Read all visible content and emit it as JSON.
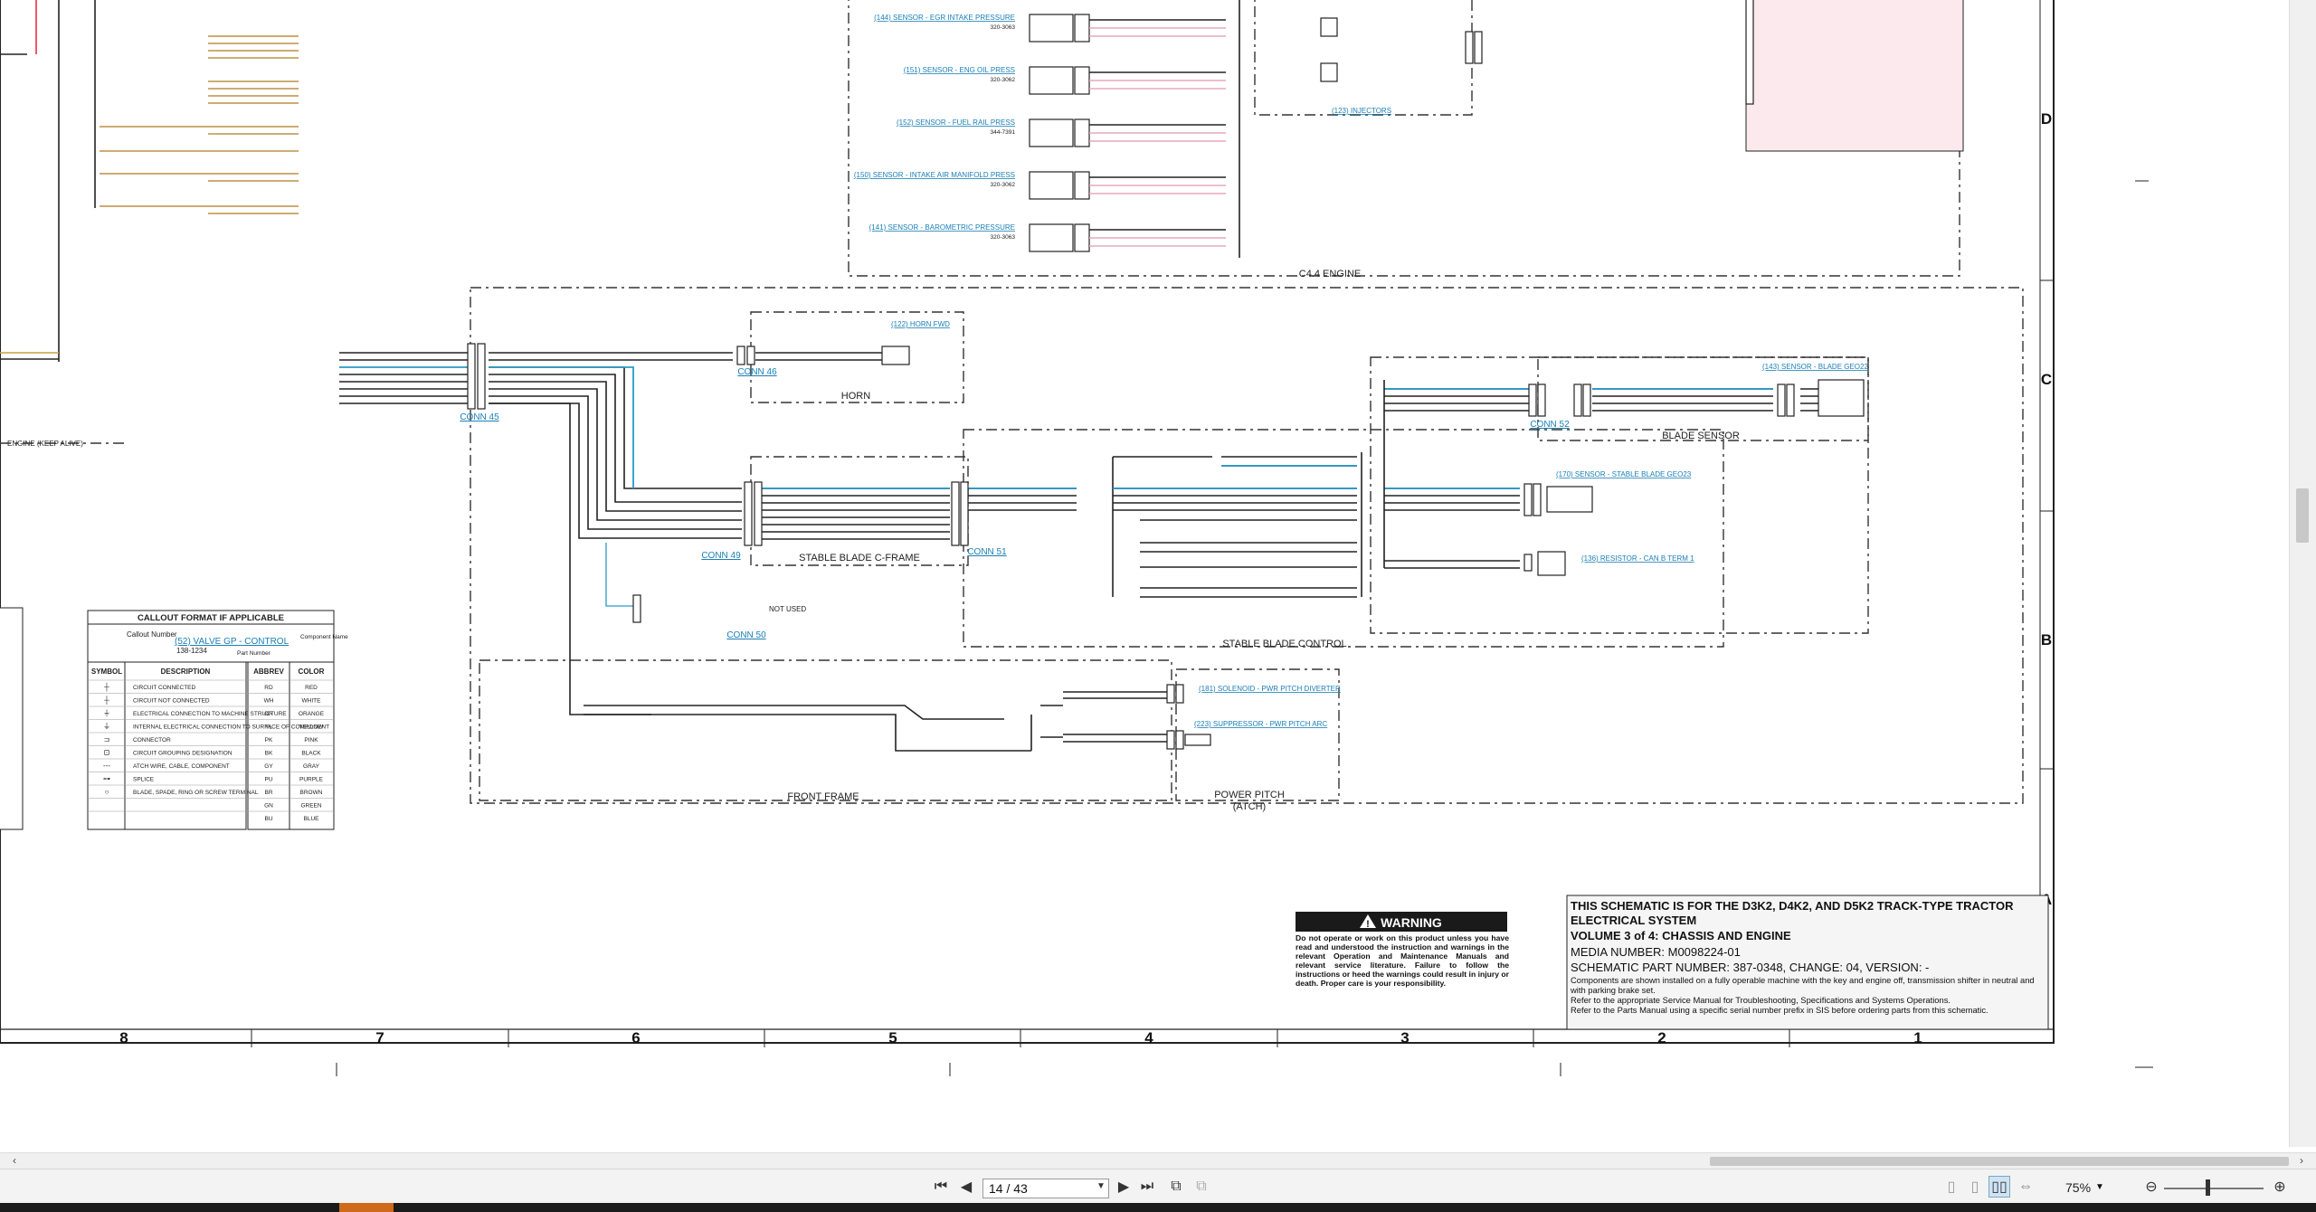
{
  "toolbar": {
    "page_current": "14 / 43",
    "zoom": "75%",
    "icons": [
      "first-page-icon",
      "prev-page-icon",
      "next-page-icon",
      "last-page-icon",
      "fit-page-icon",
      "fit-width-icon",
      "single-page-icon",
      "continuous-icon",
      "two-page-icon",
      "spread-icon",
      "zoom-out-icon",
      "zoom-in-icon"
    ]
  },
  "zones_bottom": [
    "8",
    "7",
    "6",
    "5",
    "4",
    "3",
    "2",
    "1"
  ],
  "zones_side": [
    "D",
    "C",
    "B",
    "A"
  ],
  "groups": {
    "engine": "C4.4 ENGINE",
    "horn": "HORN",
    "c_frame": "STABLE BLADE C-FRAME",
    "blade_control": "STABLE BLADE CONTROL",
    "blade_sensor": "BLADE SENSOR",
    "front_frame": "FRONT FRAME",
    "power_pitch": "POWER PITCH",
    "power_pitch_sub": "(ATCH)",
    "engine_keep_alive": "ENGINE (KEEP ALIVE)",
    "not_used": "NOT USED",
    "injector_link": "(123) INJECTORS"
  },
  "connectors": {
    "conn45": "CONN 45",
    "conn46": "CONN 46",
    "conn49": "CONN 49",
    "conn50": "CONN 50",
    "conn51": "CONN 51",
    "conn52": "CONN 52"
  },
  "sensor_links": [
    "(144) SENSOR - EGR INTAKE PRESSURE",
    "(151) SENSOR - ENG OIL PRESS",
    "(152) SENSOR - FUEL RAIL PRESS",
    "(150) SENSOR - INTAKE AIR MANIFOLD PRESS",
    "(141) SENSOR - BAROMETRIC PRESSURE"
  ],
  "sensor_parts": [
    "320-3063",
    "320-3062",
    "344-7391",
    "320-3062",
    "320-3063"
  ],
  "other_links": {
    "horn": "(122) HORN FWD",
    "blade_sensor": "(143) SENSOR - BLADE GEO22",
    "stable_blade": "(170) SENSOR - STABLE BLADE GEO23",
    "resistor": "(136) RESISTOR - CAN B TERM 1",
    "solenoid": "(181) SOLENOID - PWR PITCH DIVERTER",
    "suppressor": "(223) SUPPRESSOR - PWR PITCH ARC"
  },
  "callout": {
    "title": "CALLOUT FORMAT IF APPLICABLE",
    "callout_number": "Callout Number",
    "example": "(52) VALVE GP - CONTROL",
    "part": "138-1234",
    "component_name": "Component Name",
    "part_number": "Part Number",
    "headers": [
      "SYMBOL",
      "DESCRIPTION",
      "ABBREV",
      "COLOR"
    ],
    "rows": [
      [
        "CIRCUIT CONNECTED",
        "RD",
        "RED"
      ],
      [
        "CIRCUIT NOT CONNECTED",
        "WH",
        "WHITE"
      ],
      [
        "ELECTRICAL CONNECTION TO MACHINE STRUCTURE",
        "OR",
        "ORANGE"
      ],
      [
        "INTERNAL ELECTRICAL CONNECTION TO SURFACE OF COMPONENT",
        "YL",
        "YELLOW"
      ],
      [
        "CONNECTOR",
        "PK",
        "PINK"
      ],
      [
        "CIRCUIT GROUPING DESIGNATION",
        "BK",
        "BLACK"
      ],
      [
        "ATCH WIRE, CABLE, COMPONENT",
        "GY",
        "GRAY"
      ],
      [
        "SPLICE",
        "PU",
        "PURPLE"
      ],
      [
        "BLADE, SPADE, RING OR SCREW TERMINAL",
        "BR",
        "BROWN"
      ],
      [
        "",
        "GN",
        "GREEN"
      ],
      [
        "",
        "BU",
        "BLUE"
      ]
    ]
  },
  "warning": {
    "title": "WARNING",
    "text": "Do not operate or work on this product unless you have read and understood the instruction and warnings in the relevant Operation and Maintenance Manuals and relevant service literature. Failure to follow the instructions or heed the warnings could result in injury or death. Proper care is your responsibility."
  },
  "titleblock": {
    "line1": "THIS SCHEMATIC IS FOR THE D3K2, D4K2, AND D5K2 TRACK-TYPE TRACTOR",
    "line2": "ELECTRICAL SYSTEM",
    "line3": "VOLUME 3 of 4: CHASSIS AND ENGINE",
    "media": "MEDIA NUMBER: M0098224-01",
    "part": "SCHEMATIC PART NUMBER: 387-0348, CHANGE: 04, VERSION: -",
    "note1": "Components are shown installed on a fully operable machine with the key and engine off, transmission shifter in neutral and with parking brake set.",
    "note2": "Refer to the appropriate Service Manual for Troubleshooting, Specifications and Systems Operations.",
    "note3": "Refer to the Parts Manual using a specific serial number prefix in SIS before ordering parts from this schematic."
  },
  "colors": {
    "link_blue": "#1a7fb5",
    "wire_blue": "#2a9ac8",
    "wire_pink": "#e7a9bc",
    "ecm_fill": "#fbe9ee"
  }
}
